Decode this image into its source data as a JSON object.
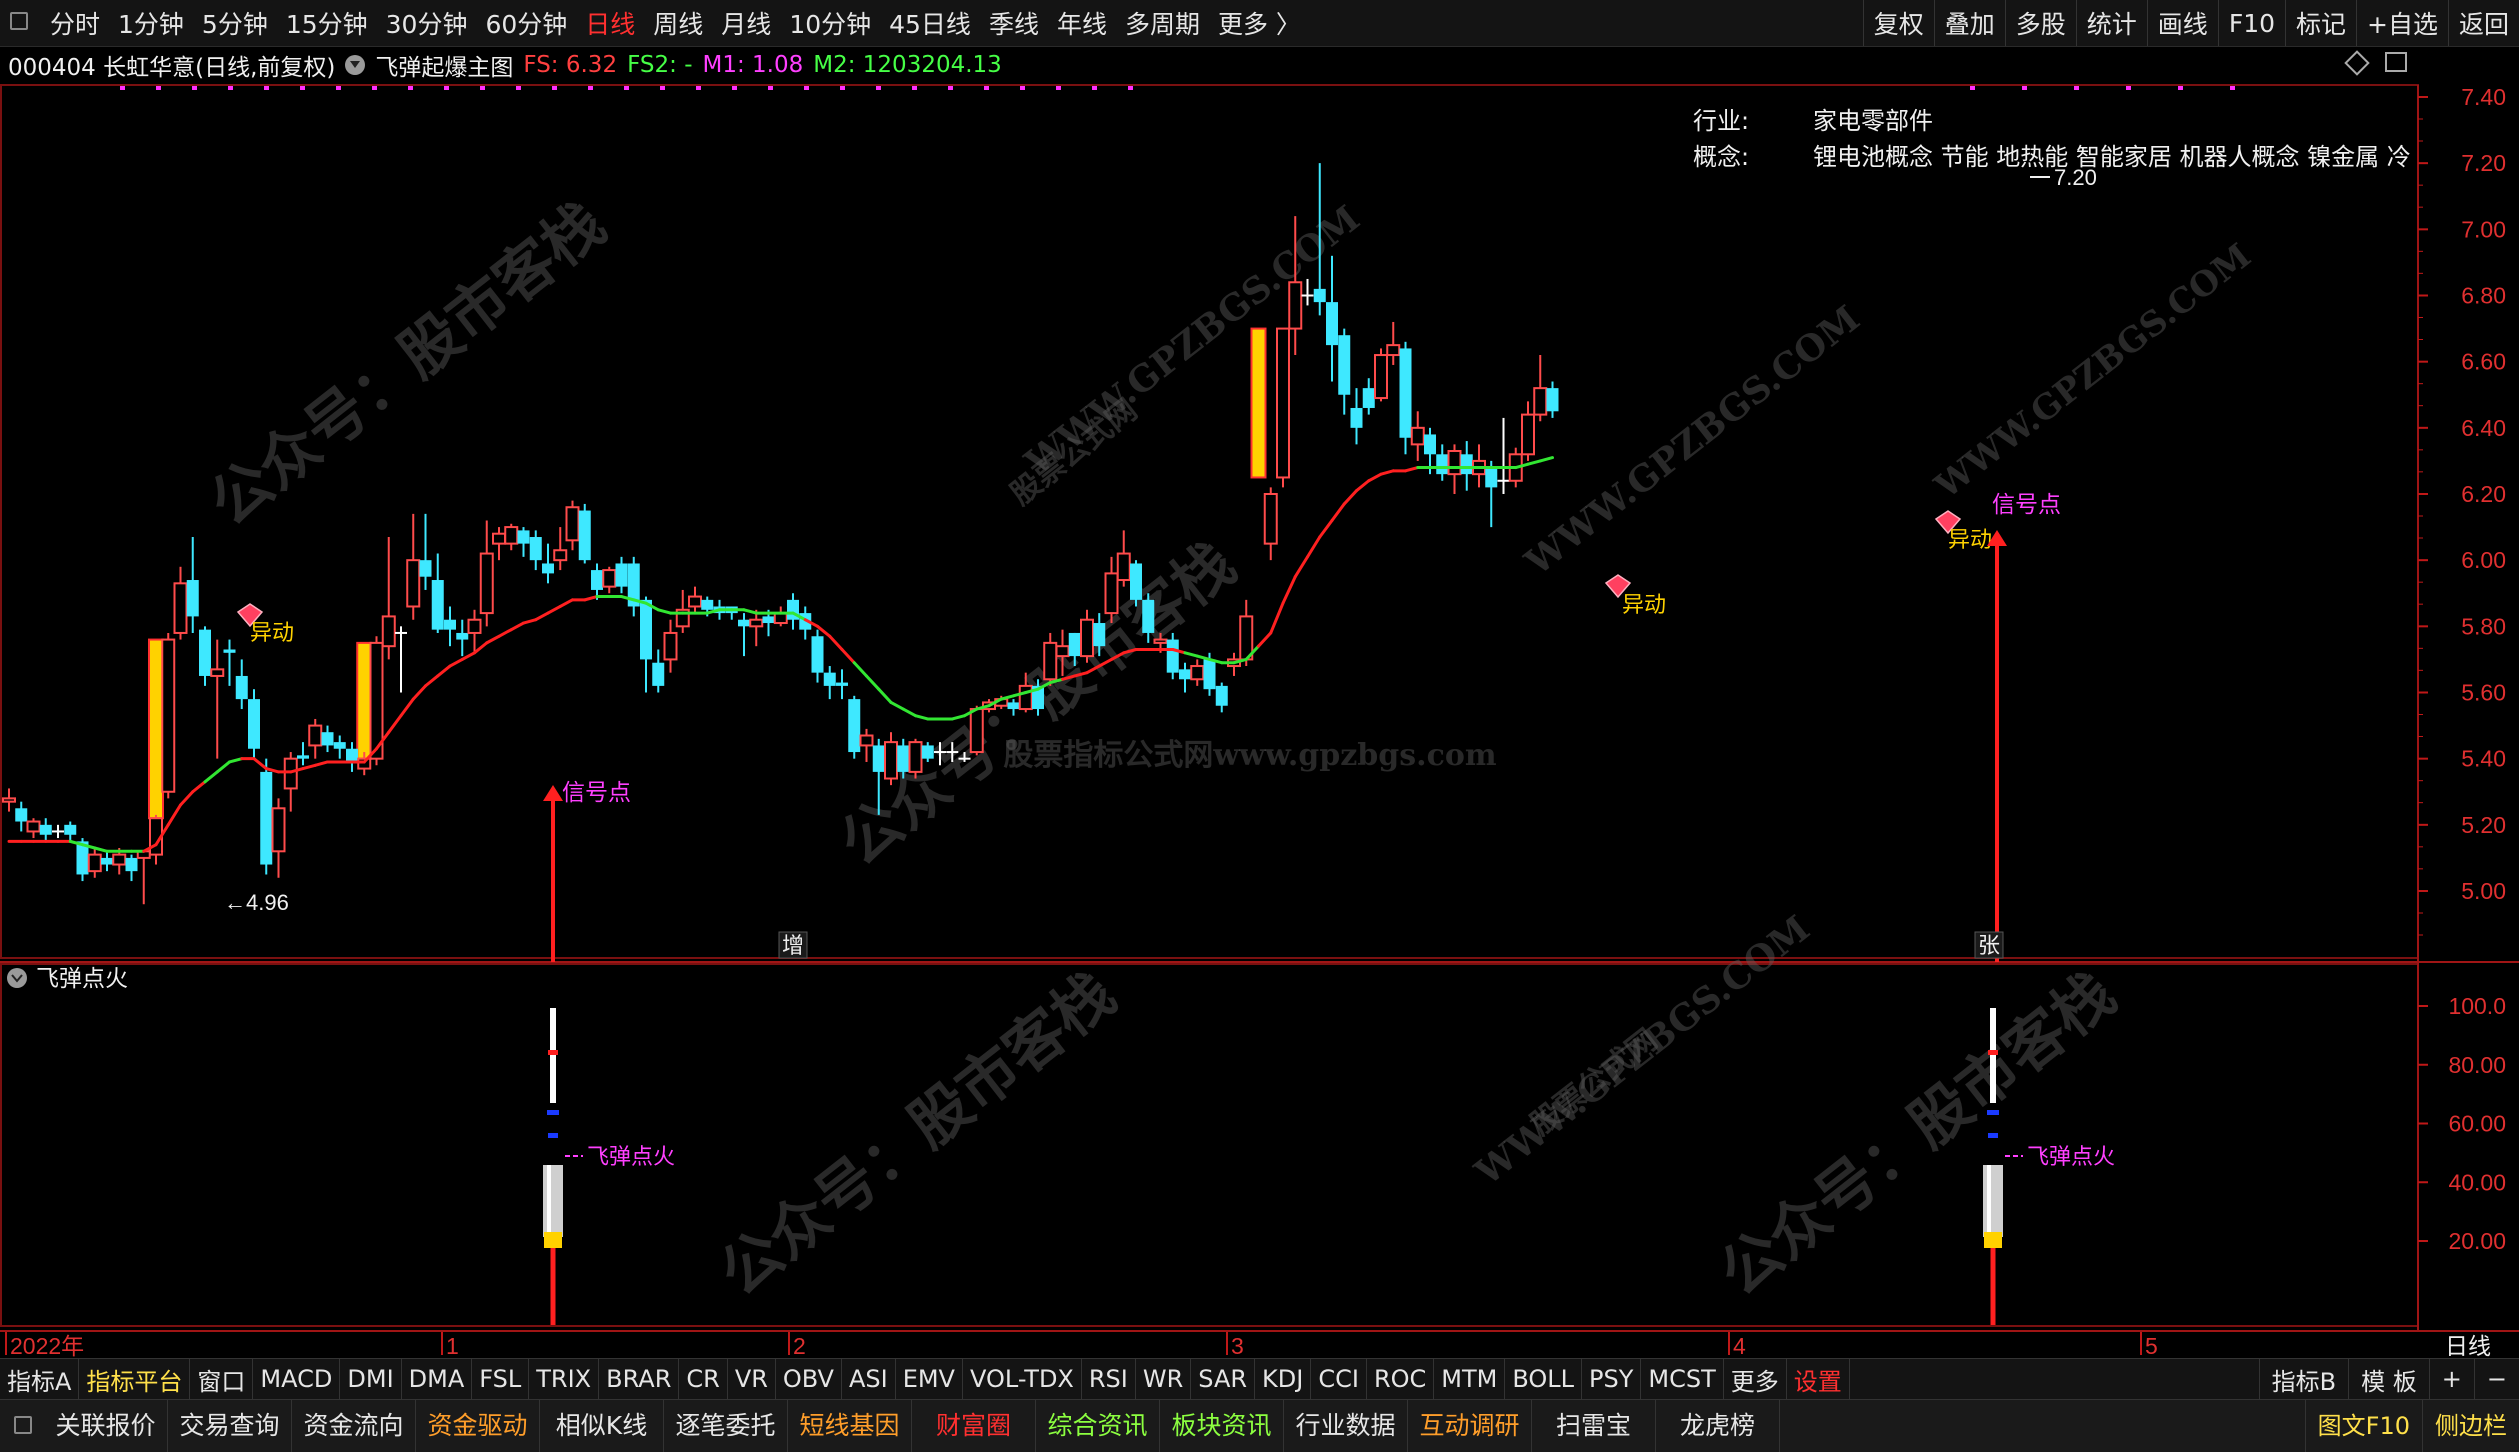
{
  "toolbar": {
    "periods": [
      "分时",
      "1分钟",
      "5分钟",
      "15分钟",
      "30分钟",
      "60分钟",
      "日线",
      "周线",
      "月线",
      "10分钟",
      "45日线",
      "季线",
      "年线",
      "多周期",
      "更多 〉"
    ],
    "active_period": "日线",
    "right_buttons": [
      "复权",
      "叠加",
      "多股",
      "统计",
      "画线",
      "F10",
      "标记",
      "+自选",
      "返回"
    ]
  },
  "info": {
    "stock": "000404 长虹华意(日线,前复权)",
    "indicator": "飞弹起爆主图",
    "fs": "FS: 6.32",
    "fs2": "FS2: -",
    "m1": "M1: 1.08",
    "m2": "M2: 1203204.13",
    "industry_label": "行业:",
    "industry_value": "家电零部件",
    "concept_label": "概念:",
    "concept_value": "锂电池概念 节能 地热能 智能家居 机器人概念 镍金属 冷"
  },
  "sub": {
    "title": "飞弹点火",
    "ticks": [
      "100.0",
      "80.00",
      "60.00",
      "40.00",
      "20.00"
    ],
    "labels": [
      "飞弹点火",
      "飞弹点火"
    ]
  },
  "time_axis": {
    "labels": [
      "2022年",
      "1",
      "2",
      "3",
      "4",
      "5"
    ],
    "right": "日线"
  },
  "annotations": {
    "low_label": "←4.96",
    "high_label": "7.20",
    "yidong": [
      "异动",
      "异动",
      "异动"
    ],
    "signal": [
      "信号点",
      "信号点"
    ],
    "markers": [
      "增",
      "张"
    ]
  },
  "watermarks": [
    "公众号：股市客栈",
    "WWW.GPZBGS.COM",
    "股票公式网",
    "股票指标公式网www.gpzbgs.com"
  ],
  "indicator_tabs": [
    "指标A",
    "指标平台",
    "窗口",
    "MACD",
    "DMI",
    "DMA",
    "FSL",
    "TRIX",
    "BRAR",
    "CR",
    "VR",
    "OBV",
    "ASI",
    "EMV",
    "VOL-TDX",
    "RSI",
    "WR",
    "SAR",
    "KDJ",
    "CCI",
    "ROC",
    "MTM",
    "BOLL",
    "PSY",
    "MCST",
    "更多",
    "设置"
  ],
  "indicator_right": [
    "指标B",
    "模 板",
    "+",
    "−"
  ],
  "func_buttons": [
    "关联报价",
    "交易查询",
    "资金流向",
    "资金驱动",
    "相似K线",
    "逐笔委托",
    "短线基因",
    "财富圈",
    "综合资讯",
    "板块资讯",
    "行业数据",
    "互动调研",
    "扫雷宝",
    "龙虎榜"
  ],
  "func_right": [
    "图文F10",
    "侧边栏"
  ],
  "chart_data": {
    "type": "candlestick",
    "y_ticks": [
      7.4,
      7.2,
      7.0,
      6.8,
      6.6,
      6.4,
      6.2,
      6.0,
      5.8,
      5.6,
      5.4,
      5.2,
      5.0
    ],
    "ylim": [
      4.8,
      7.5
    ],
    "candles": [
      [
        5.27,
        5.28,
        5.24,
        5.31
      ],
      [
        5.25,
        5.21,
        5.18,
        5.27
      ],
      [
        5.18,
        5.21,
        5.16,
        5.22
      ],
      [
        5.2,
        5.17,
        5.15,
        5.22
      ],
      [
        5.18,
        5.18,
        5.16,
        5.2
      ],
      [
        5.2,
        5.17,
        5.15,
        5.21
      ],
      [
        5.15,
        5.05,
        5.03,
        5.16
      ],
      [
        5.06,
        5.11,
        5.04,
        5.13
      ],
      [
        5.1,
        5.08,
        5.06,
        5.12
      ],
      [
        5.08,
        5.11,
        5.05,
        5.13
      ],
      [
        5.1,
        5.06,
        5.03,
        5.11
      ],
      [
        5.1,
        5.12,
        4.96,
        5.12
      ],
      [
        5.11,
        5.22,
        5.08,
        5.23
      ],
      [
        5.3,
        5.76,
        5.28,
        5.78
      ],
      [
        5.78,
        5.93,
        5.76,
        5.98
      ],
      [
        5.94,
        5.83,
        5.78,
        6.07
      ],
      [
        5.79,
        5.65,
        5.62,
        5.8
      ],
      [
        5.65,
        5.67,
        5.4,
        5.76
      ],
      [
        5.73,
        5.72,
        5.62,
        5.76
      ],
      [
        5.65,
        5.58,
        5.55,
        5.7
      ],
      [
        5.58,
        5.43,
        5.4,
        5.61
      ],
      [
        5.36,
        5.08,
        5.05,
        5.4
      ],
      [
        5.12,
        5.25,
        5.04,
        5.28
      ],
      [
        5.31,
        5.4,
        5.24,
        5.42
      ],
      [
        5.41,
        5.4,
        5.38,
        5.45
      ],
      [
        5.44,
        5.5,
        5.4,
        5.52
      ],
      [
        5.48,
        5.44,
        5.42,
        5.5
      ],
      [
        5.45,
        5.43,
        5.4,
        5.47
      ],
      [
        5.43,
        5.39,
        5.36,
        5.45
      ],
      [
        5.37,
        5.4,
        5.35,
        5.42
      ],
      [
        5.4,
        5.75,
        5.38,
        5.77
      ],
      [
        5.74,
        5.83,
        5.7,
        6.07
      ],
      [
        5.78,
        5.78,
        5.6,
        5.8
      ],
      [
        5.86,
        6.0,
        5.82,
        6.14
      ],
      [
        6.0,
        5.95,
        5.91,
        6.14
      ],
      [
        5.94,
        5.79,
        5.78,
        6.02
      ],
      [
        5.82,
        5.79,
        5.74,
        5.86
      ],
      [
        5.78,
        5.76,
        5.71,
        5.82
      ],
      [
        5.78,
        5.82,
        5.72,
        5.85
      ],
      [
        5.84,
        6.02,
        5.8,
        6.12
      ],
      [
        6.05,
        6.08,
        6.0,
        6.1
      ],
      [
        6.05,
        6.1,
        6.03,
        6.11
      ],
      [
        6.09,
        6.05,
        6.01,
        6.1
      ],
      [
        6.07,
        6.0,
        5.97,
        6.09
      ],
      [
        5.99,
        5.96,
        5.93,
        6.05
      ],
      [
        6.0,
        6.03,
        5.97,
        6.1
      ],
      [
        6.06,
        6.16,
        6.03,
        6.18
      ],
      [
        6.15,
        6.0,
        5.99,
        6.17
      ],
      [
        5.97,
        5.91,
        5.88,
        5.99
      ],
      [
        5.92,
        5.97,
        5.9,
        5.98
      ],
      [
        5.99,
        5.92,
        5.9,
        6.01
      ],
      [
        5.99,
        5.86,
        5.83,
        6.01
      ],
      [
        5.88,
        5.7,
        5.6,
        5.89
      ],
      [
        5.69,
        5.62,
        5.6,
        5.73
      ],
      [
        5.7,
        5.78,
        5.66,
        5.82
      ],
      [
        5.8,
        5.85,
        5.78,
        5.91
      ],
      [
        5.86,
        5.89,
        5.84,
        5.92
      ],
      [
        5.88,
        5.85,
        5.83,
        5.89
      ],
      [
        5.86,
        5.84,
        5.82,
        5.88
      ],
      [
        5.86,
        5.84,
        5.82,
        5.86
      ],
      [
        5.82,
        5.8,
        5.71,
        5.84
      ],
      [
        5.8,
        5.82,
        5.74,
        5.85
      ],
      [
        5.83,
        5.81,
        5.77,
        5.85
      ],
      [
        5.81,
        5.84,
        5.8,
        5.86
      ],
      [
        5.88,
        5.82,
        5.79,
        5.9
      ],
      [
        5.84,
        5.79,
        5.76,
        5.86
      ],
      [
        5.77,
        5.66,
        5.63,
        5.79
      ],
      [
        5.66,
        5.62,
        5.58,
        5.68
      ],
      [
        5.63,
        5.62,
        5.58,
        5.67
      ],
      [
        5.58,
        5.42,
        5.4,
        5.59
      ],
      [
        5.44,
        5.47,
        5.39,
        5.49
      ],
      [
        5.44,
        5.36,
        5.23,
        5.46
      ],
      [
        5.34,
        5.45,
        5.32,
        5.48
      ],
      [
        5.44,
        5.36,
        5.34,
        5.46
      ],
      [
        5.36,
        5.45,
        5.34,
        5.46
      ],
      [
        5.44,
        5.4,
        5.39,
        5.45
      ],
      [
        5.42,
        5.42,
        5.38,
        5.45
      ],
      [
        5.42,
        5.42,
        5.39,
        5.45
      ],
      [
        5.4,
        5.4,
        5.39,
        5.42
      ],
      [
        5.42,
        5.55,
        5.41,
        5.56
      ],
      [
        5.55,
        5.57,
        5.54,
        5.58
      ],
      [
        5.56,
        5.58,
        5.55,
        5.59
      ],
      [
        5.57,
        5.55,
        5.53,
        5.58
      ],
      [
        5.55,
        5.62,
        5.54,
        5.66
      ],
      [
        5.62,
        5.55,
        5.53,
        5.64
      ],
      [
        5.64,
        5.75,
        5.62,
        5.78
      ],
      [
        5.71,
        5.74,
        5.65,
        5.79
      ],
      [
        5.78,
        5.71,
        5.68,
        5.78
      ],
      [
        5.71,
        5.82,
        5.69,
        5.85
      ],
      [
        5.81,
        5.74,
        5.71,
        5.84
      ],
      [
        5.84,
        5.96,
        5.81,
        6.01
      ],
      [
        5.94,
        6.02,
        5.92,
        6.09
      ],
      [
        5.99,
        5.88,
        5.86,
        6.0
      ],
      [
        5.88,
        5.78,
        5.75,
        5.9
      ],
      [
        5.75,
        5.76,
        5.72,
        5.78
      ],
      [
        5.76,
        5.66,
        5.64,
        5.78
      ],
      [
        5.67,
        5.64,
        5.6,
        5.69
      ],
      [
        5.64,
        5.68,
        5.62,
        5.7
      ],
      [
        5.7,
        5.61,
        5.59,
        5.72
      ],
      [
        5.62,
        5.56,
        5.54,
        5.63
      ],
      [
        5.68,
        5.7,
        5.65,
        5.72
      ],
      [
        5.7,
        5.83,
        5.68,
        5.88
      ],
      [
        5.85,
        6.05,
        5.83,
        6.09
      ],
      [
        6.05,
        6.2,
        6.0,
        6.22
      ],
      [
        6.25,
        6.7,
        6.22,
        6.7
      ],
      [
        6.7,
        6.84,
        6.62,
        7.04
      ],
      [
        6.8,
        6.8,
        6.77,
        6.85
      ],
      [
        6.82,
        6.78,
        6.74,
        7.2
      ],
      [
        6.78,
        6.65,
        6.54,
        6.92
      ],
      [
        6.68,
        6.5,
        6.44,
        6.7
      ],
      [
        6.46,
        6.4,
        6.35,
        6.52
      ],
      [
        6.52,
        6.46,
        6.44,
        6.55
      ],
      [
        6.49,
        6.62,
        6.48,
        6.64
      ],
      [
        6.62,
        6.65,
        6.59,
        6.72
      ],
      [
        6.64,
        6.37,
        6.32,
        6.66
      ],
      [
        6.35,
        6.4,
        6.3,
        6.45
      ],
      [
        6.38,
        6.32,
        6.26,
        6.4
      ],
      [
        6.32,
        6.26,
        6.24,
        6.35
      ],
      [
        6.26,
        6.33,
        6.2,
        6.35
      ],
      [
        6.32,
        6.26,
        6.21,
        6.36
      ],
      [
        6.26,
        6.3,
        6.22,
        6.35
      ],
      [
        6.28,
        6.22,
        6.1,
        6.3
      ],
      [
        6.24,
        6.24,
        6.2,
        6.43
      ],
      [
        6.24,
        6.32,
        6.22,
        6.34
      ],
      [
        6.32,
        6.44,
        6.3,
        6.48
      ],
      [
        6.44,
        6.52,
        6.42,
        6.62
      ],
      [
        6.52,
        6.45,
        6.43,
        6.54
      ]
    ],
    "ma": [
      5.15,
      5.15,
      5.15,
      5.15,
      5.15,
      5.15,
      5.14,
      5.13,
      5.12,
      5.12,
      5.12,
      5.12,
      5.14,
      5.2,
      5.26,
      5.3,
      5.33,
      5.36,
      5.39,
      5.4,
      5.4,
      5.37,
      5.36,
      5.36,
      5.37,
      5.38,
      5.39,
      5.39,
      5.39,
      5.39,
      5.43,
      5.48,
      5.53,
      5.58,
      5.62,
      5.65,
      5.68,
      5.7,
      5.72,
      5.75,
      5.77,
      5.79,
      5.81,
      5.82,
      5.84,
      5.86,
      5.88,
      5.88,
      5.89,
      5.89,
      5.89,
      5.88,
      5.87,
      5.85,
      5.84,
      5.84,
      5.84,
      5.84,
      5.85,
      5.85,
      5.85,
      5.84,
      5.84,
      5.84,
      5.84,
      5.82,
      5.8,
      5.77,
      5.73,
      5.69,
      5.65,
      5.61,
      5.57,
      5.55,
      5.53,
      5.52,
      5.52,
      5.52,
      5.53,
      5.55,
      5.56,
      5.58,
      5.59,
      5.6,
      5.61,
      5.63,
      5.64,
      5.65,
      5.66,
      5.68,
      5.7,
      5.72,
      5.73,
      5.73,
      5.73,
      5.73,
      5.72,
      5.71,
      5.7,
      5.69,
      5.69,
      5.7,
      5.74,
      5.78,
      5.87,
      5.95,
      6.01,
      6.07,
      6.12,
      6.17,
      6.21,
      6.24,
      6.26,
      6.27,
      6.27,
      6.28,
      6.28,
      6.28,
      6.28,
      6.28,
      6.28,
      6.28,
      6.28,
      6.28,
      6.29,
      6.3,
      6.31
    ],
    "ma_green_ranges": [
      [
        5,
        10
      ],
      [
        16,
        18
      ],
      [
        48,
        64
      ],
      [
        69,
        85
      ],
      [
        96,
        101
      ],
      [
        115,
        126
      ]
    ],
    "signals": [
      29,
      102
    ],
    "yidong": [
      12,
      85,
      101
    ],
    "sub_ylim": [
      0,
      110
    ],
    "sub_ticks": [
      100,
      80,
      60,
      40,
      20
    ]
  }
}
